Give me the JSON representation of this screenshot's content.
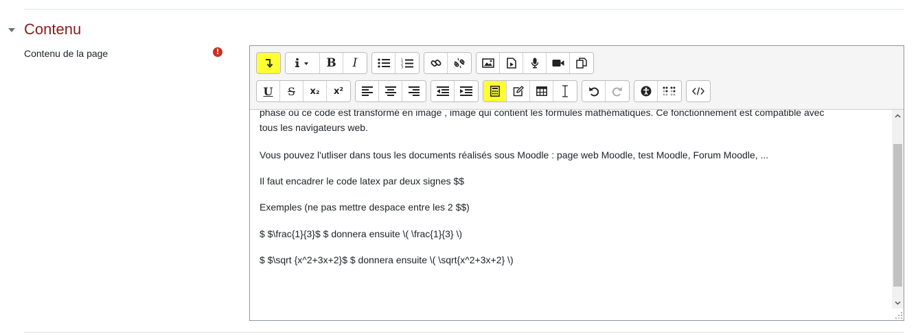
{
  "section": {
    "title": "Contenu",
    "collapse_icon": "caret-down-icon"
  },
  "field": {
    "label": "Contenu de la page",
    "required_icon": "exclamation-circle-icon",
    "required_mark": "!"
  },
  "toolbar": {
    "row1": [
      {
        "name": "collapse-toolbar-button",
        "icon": "arrow-down-return-icon",
        "highlighted": true
      },
      {
        "name": "style-button",
        "icon": "info-dropdown-icon",
        "highlighted": false
      },
      {
        "name": "bold-button",
        "icon": "bold-icon",
        "label": "B",
        "highlighted": false
      },
      {
        "name": "italic-button",
        "icon": "italic-icon",
        "label": "I",
        "highlighted": false
      },
      {
        "name": "unordered-list-button",
        "icon": "bullet-list-icon",
        "highlighted": false
      },
      {
        "name": "ordered-list-button",
        "icon": "numbered-list-icon",
        "highlighted": false
      },
      {
        "name": "link-button",
        "icon": "link-icon",
        "highlighted": false
      },
      {
        "name": "unlink-button",
        "icon": "unlink-icon",
        "highlighted": false
      },
      {
        "name": "image-button",
        "icon": "image-icon",
        "highlighted": false
      },
      {
        "name": "media-button",
        "icon": "file-media-icon",
        "highlighted": false
      },
      {
        "name": "record-audio-button",
        "icon": "microphone-icon",
        "highlighted": false
      },
      {
        "name": "record-video-button",
        "icon": "video-camera-icon",
        "highlighted": false
      },
      {
        "name": "manage-files-button",
        "icon": "files-icon",
        "highlighted": false
      }
    ],
    "row2": [
      {
        "name": "underline-button",
        "icon": "underline-icon",
        "label": "U"
      },
      {
        "name": "strikethrough-button",
        "icon": "strikethrough-icon",
        "label": "S"
      },
      {
        "name": "subscript-button",
        "icon": "subscript-icon",
        "label": "x₂"
      },
      {
        "name": "superscript-button",
        "icon": "superscript-icon",
        "label": "x²"
      },
      {
        "name": "align-left-button",
        "icon": "align-left-icon"
      },
      {
        "name": "align-center-button",
        "icon": "align-center-icon"
      },
      {
        "name": "align-right-button",
        "icon": "align-right-icon"
      },
      {
        "name": "outdent-button",
        "icon": "outdent-icon"
      },
      {
        "name": "indent-button",
        "icon": "indent-icon"
      },
      {
        "name": "equation-button",
        "icon": "calculator-icon",
        "highlighted": true
      },
      {
        "name": "special-character-button",
        "icon": "pencil-square-icon"
      },
      {
        "name": "table-button",
        "icon": "table-icon"
      },
      {
        "name": "clear-formatting-button",
        "icon": "i-beam-icon"
      },
      {
        "name": "undo-button",
        "icon": "undo-icon"
      },
      {
        "name": "redo-button",
        "icon": "redo-icon"
      },
      {
        "name": "accessibility-checker-button",
        "icon": "accessibility-icon"
      },
      {
        "name": "screenreader-helper-button",
        "icon": "braille-icon"
      },
      {
        "name": "html-button",
        "icon": "code-icon"
      }
    ]
  },
  "content": {
    "partial_line": "phase où ce code est transformé en image , image qui contient les formules mathématiques. Ce fonctionnement est compatible avec",
    "continuation": "tous les navigateurs web.",
    "paragraphs": [
      "Vous pouvez l'utliser dans tous les documents réalisés sous Moodle : page web Moodle, test Moodle, Forum Moodle,  ...",
      "Il faut encadrer le code latex par deux signes $$",
      "Exemples (ne pas mettre despace entre les 2 $$)",
      "$ $\\frac{1}{3}$ $ donnera ensuite \\( \\frac{1}{3} \\)",
      "$ $\\sqrt {x^2+3x+2}$ $ donnera ensuite \\( \\sqrt{x^2+3x+2} \\)"
    ]
  },
  "colors": {
    "section_title": "#8c1b1b",
    "required": "#ca3120",
    "highlight": "#ffff33"
  }
}
